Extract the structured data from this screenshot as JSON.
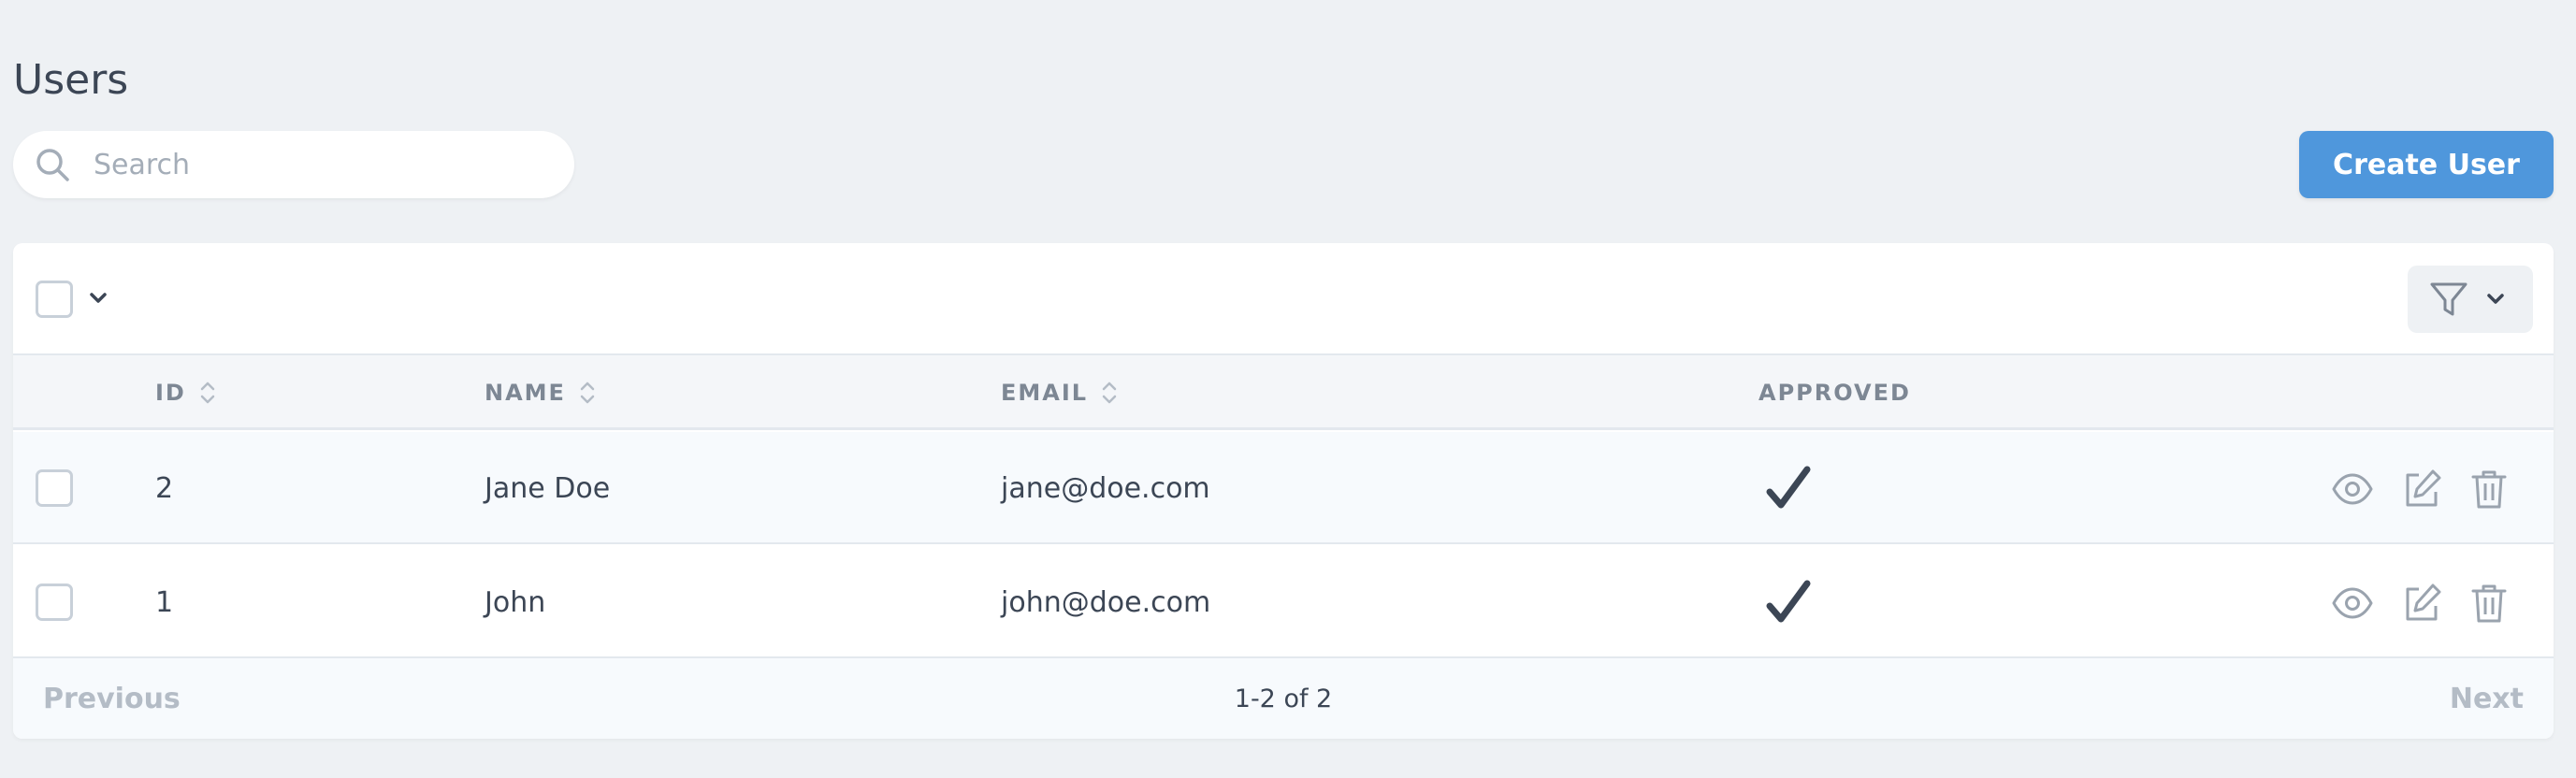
{
  "page": {
    "title": "Users"
  },
  "search": {
    "placeholder": "Search",
    "value": "",
    "icon": "search-icon"
  },
  "toolbar": {
    "create_label": "Create User",
    "select_all_checked": false,
    "filter_icon": "funnel-icon"
  },
  "table": {
    "columns": [
      {
        "key": "id",
        "label": "ID",
        "sortable": true
      },
      {
        "key": "name",
        "label": "NAME",
        "sortable": true
      },
      {
        "key": "email",
        "label": "EMAIL",
        "sortable": true
      },
      {
        "key": "approved",
        "label": "APPROVED",
        "sortable": false
      }
    ],
    "rows": [
      {
        "id": "2",
        "name": "Jane Doe",
        "email": "jane@doe.com",
        "approved": true
      },
      {
        "id": "1",
        "name": "John",
        "email": "john@doe.com",
        "approved": true
      }
    ],
    "row_actions": [
      "view-icon",
      "edit-icon",
      "delete-icon"
    ]
  },
  "pagination": {
    "previous": "Previous",
    "range": "1-2 of 2",
    "next": "Next"
  },
  "colors": {
    "background": "#eef1f4",
    "primary": "#4f97dc",
    "text": "#3c4655",
    "muted": "#7d8794",
    "disabled": "#b4bcc6"
  }
}
